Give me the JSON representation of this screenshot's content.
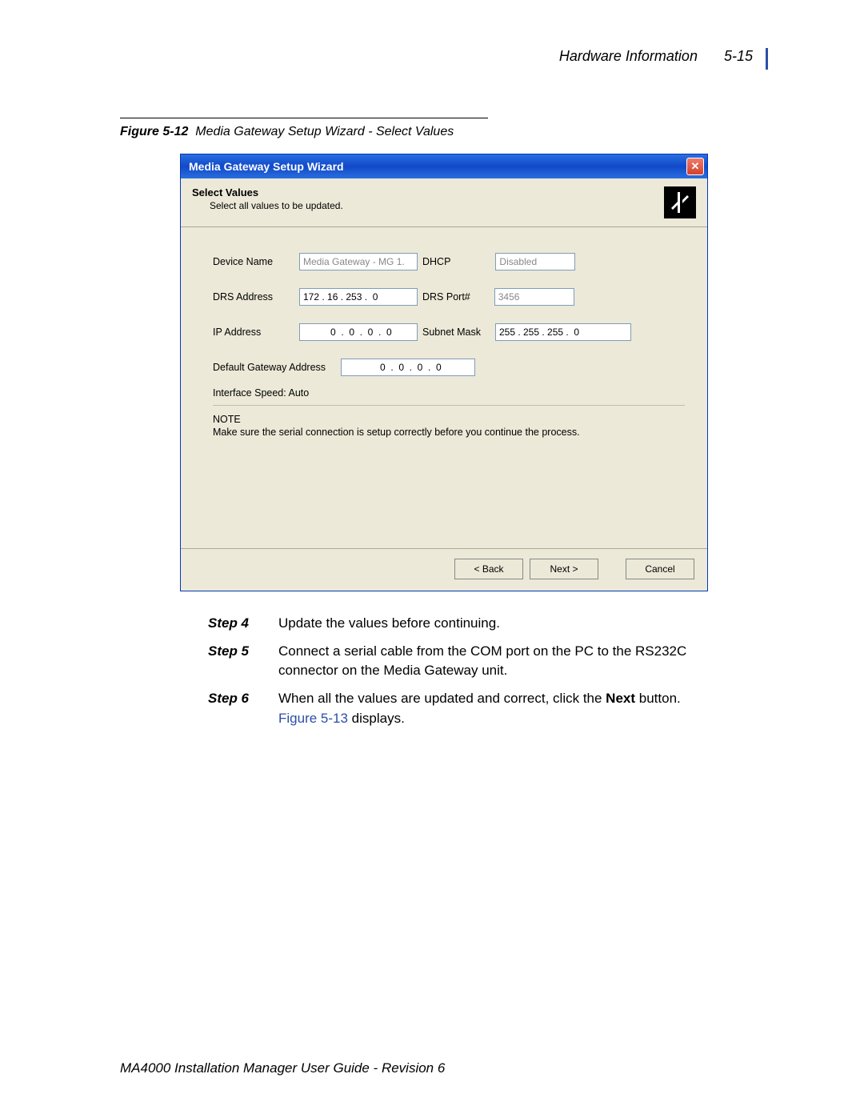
{
  "header": {
    "section": "Hardware Information",
    "page": "5-15"
  },
  "caption": {
    "prefix": "Figure 5-12",
    "text": "Media Gateway Setup Wizard - Select Values"
  },
  "wizard": {
    "title": "Media Gateway Setup Wizard",
    "heading": "Select Values",
    "subheading": "Select all values to be updated.",
    "fields": {
      "device_name_label": "Device Name",
      "device_name_value": "Media Gateway - MG 1.",
      "dhcp_label": "DHCP",
      "dhcp_value": "Disabled",
      "drs_addr_label": "DRS Address",
      "drs_addr_value": "172 . 16 . 253 .  0",
      "drs_port_label": "DRS Port#",
      "drs_port_value": "3456",
      "ip_addr_label": "IP Address",
      "ip_addr_value": "  0  .  0  .  0  .  0",
      "subnet_label": "Subnet Mask",
      "subnet_value": "255 . 255 . 255 .  0",
      "gw_label": "Default Gateway Address",
      "gw_value": "  0  .  0  .  0  .  0",
      "ifspeed": "Interface Speed: Auto"
    },
    "note": {
      "title": "NOTE",
      "body": "Make sure the serial connection is setup correctly before you continue the process."
    },
    "buttons": {
      "back": "< Back",
      "next": "Next >",
      "cancel": "Cancel"
    }
  },
  "steps": [
    {
      "label": "Step 4",
      "text": "Update the values before continuing."
    },
    {
      "label": "Step 5",
      "text": "Connect a serial cable from the COM port on the PC to the RS232C connector on the Media Gateway unit."
    },
    {
      "label": "Step 6",
      "text_pre": "When all the values are updated and correct, click the ",
      "bold": "Next",
      "text_mid": " button. ",
      "link": "Figure 5-13",
      "text_post": " displays."
    }
  ],
  "footer": "MA4000 Installation Manager User Guide - Revision 6"
}
